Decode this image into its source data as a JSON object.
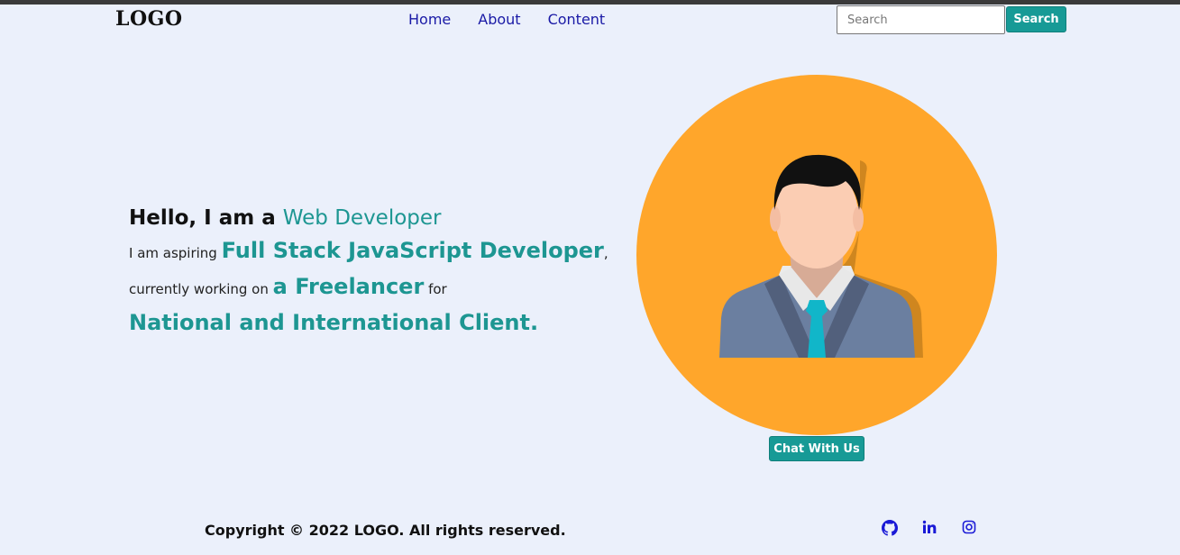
{
  "header": {
    "logo": "LOGO",
    "nav": [
      "Home",
      "About",
      "Content"
    ],
    "search": {
      "placeholder": "Search",
      "value": "",
      "button_label": "Search"
    }
  },
  "hero": {
    "line1_prefix": "Hello, I am a ",
    "line1_highlight": "Web Developer",
    "line2_prefix": "I am aspiring ",
    "line2_highlight": "Full Stack JavaScript Developer",
    "line2_suffix": ",",
    "line3_prefix": "currently working on ",
    "line3_highlight": "a Freelancer",
    "line3_suffix": " for",
    "line4": "National and International Client.",
    "chat_button": "Chat With Us"
  },
  "footer": {
    "copyright": "Copyright © 2022 LOGO. All rights reserved.",
    "social_icons": [
      "github-icon",
      "linkedin-icon",
      "instagram-icon"
    ]
  },
  "colors": {
    "background": "#ebf0fb",
    "accent": "#179a96",
    "avatar_bg": "#ffa62b",
    "nav_link": "#1a1aa6"
  }
}
